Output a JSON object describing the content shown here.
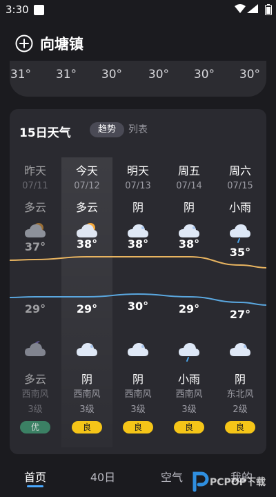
{
  "status_bar": {
    "time": "3:30"
  },
  "header": {
    "city": "向塘镇"
  },
  "hourly": {
    "temps": [
      "31°",
      "31°",
      "30°",
      "30°",
      "30°",
      "30°"
    ]
  },
  "forecast": {
    "title": "15日天气",
    "view_tabs": {
      "selected": "趋势",
      "other": "列表"
    },
    "days": [
      {
        "day": "昨天",
        "date": "07/11",
        "day_weather": "多云",
        "day_icon": "partly-cloudy-day-icon",
        "high": "37°",
        "high_value": 37,
        "low": "29°",
        "low_value": 29,
        "night_icon": "partly-cloudy-night-icon",
        "night_weather": "多云",
        "wind": "西南风",
        "level": "3级",
        "aqi": "优",
        "aqi_color": "#3f8f6e",
        "past": true
      },
      {
        "day": "今天",
        "date": "07/12",
        "day_weather": "多云",
        "day_icon": "partly-cloudy-day-icon",
        "high": "38°",
        "high_value": 38,
        "low": "29°",
        "low_value": 29,
        "night_icon": "cloudy-icon",
        "night_weather": "阴",
        "wind": "西南风",
        "level": "3级",
        "aqi": "良",
        "aqi_color": "#f5c518",
        "past": false
      },
      {
        "day": "明天",
        "date": "07/13",
        "day_weather": "阴",
        "day_icon": "cloudy-icon",
        "high": "38°",
        "high_value": 38,
        "low": "30°",
        "low_value": 30,
        "night_icon": "cloudy-icon",
        "night_weather": "阴",
        "wind": "西南风",
        "level": "3级",
        "aqi": "良",
        "aqi_color": "#f5c518",
        "past": false
      },
      {
        "day": "周五",
        "date": "07/14",
        "day_weather": "阴",
        "day_icon": "cloudy-icon",
        "high": "38°",
        "high_value": 38,
        "low": "29°",
        "low_value": 29,
        "night_icon": "light-rain-icon",
        "night_weather": "小雨",
        "wind": "西南风",
        "level": "3级",
        "aqi": "良",
        "aqi_color": "#f5c518",
        "past": false
      },
      {
        "day": "周六",
        "date": "07/15",
        "day_weather": "小雨",
        "day_icon": "light-rain-icon",
        "high": "35°",
        "high_value": 35,
        "low": "27°",
        "low_value": 27,
        "night_icon": "cloudy-icon",
        "night_weather": "阴",
        "wind": "东北风",
        "level": "2级",
        "aqi": "良",
        "aqi_color": "#f5c518",
        "past": false
      }
    ],
    "colors": {
      "high_line": "#e8b460",
      "low_line": "#5aa7df"
    }
  },
  "bottom_nav": {
    "tabs": [
      "首页",
      "40日",
      "空气",
      "我的"
    ],
    "active_index": 0
  },
  "watermark": {
    "text": "PCPOP下载"
  }
}
